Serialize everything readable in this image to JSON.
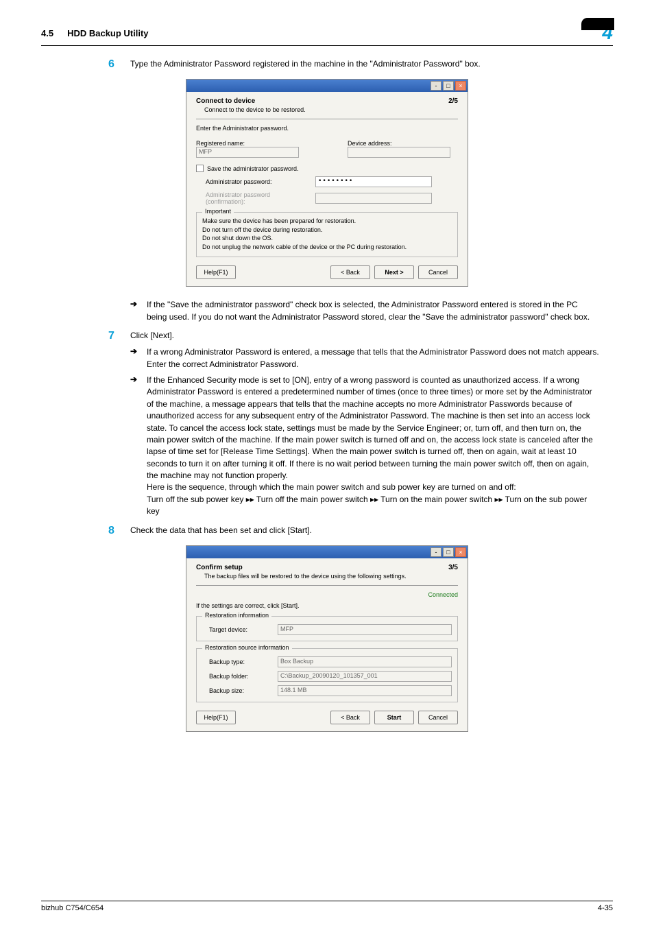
{
  "header": {
    "section_number": "4.5",
    "section_title": "HDD Backup Utility",
    "chapter_number": "4"
  },
  "steps": {
    "s6": {
      "num": "6",
      "text": "Type the Administrator Password registered in the machine in the \"Administrator Password\" box."
    },
    "s6_note": "If the \"Save the administrator password\" check box is selected, the Administrator Password entered is stored in the PC being used. If you do not want the Administrator Password stored, clear the \"Save the administrator password\" check box.",
    "s7": {
      "num": "7",
      "text": "Click [Next]."
    },
    "s7_b1": "If a wrong Administrator Password is entered, a message that tells that the Administrator Password does not match appears. Enter the correct Administrator Password.",
    "s7_b2": "If the Enhanced Security mode is set to [ON], entry of a wrong password is counted as unauthorized access. If a wrong Administrator Password is entered a predetermined number of times (once to three times) or more set by the Administrator of the machine, a message appears that tells that the machine accepts no more Administrator Passwords because of unauthorized access for any subsequent entry of the Administrator Password. The machine is then set into an access lock state. To cancel the access lock state, settings must be made by the Service Engineer; or, turn off, and then turn on, the main power switch of the machine. If the main power switch is turned off and on, the access lock state is canceled after the lapse of time set for [Release Time Settings]. When the main power switch is turned off, then on again, wait at least 10 seconds to turn it on after turning it off. If there is no wait period between turning the main power switch off, then on again, the machine may not function properly.",
    "s7_b2_cont1": "Here is the sequence, through which the main power switch and sub power key are turned on and off:",
    "s7_b2_cont2": "Turn off the sub power key ▸▸ Turn off the main power switch ▸▸ Turn on the main power switch ▸▸ Turn on the sub power key",
    "s8": {
      "num": "8",
      "text": "Check the data that has been set and click [Start]."
    }
  },
  "dialog1": {
    "title": "Connect to device",
    "subtitle": "Connect to the device to be restored.",
    "step": "2/5",
    "enter_pw": "Enter the Administrator password.",
    "reg_name_label": "Registered name:",
    "reg_name_value": "MFP",
    "dev_addr_label": "Device address:",
    "dev_addr_value": "",
    "save_pw": "Save the administrator password.",
    "admin_pw_label": "Administrator password:",
    "admin_pw_value": "••••••••",
    "admin_pw_confirm_label": "Administrator password (confirmation):",
    "important_legend": "Important",
    "important_l1": "Make sure the device has been prepared for restoration.",
    "important_l2": "Do not turn off the device during restoration.",
    "important_l3": "Do not shut down the OS.",
    "important_l4": "Do not unplug the network cable of the device or the PC during restoration.",
    "help": "Help(F1)",
    "back": "< Back",
    "next": "Next >",
    "cancel": "Cancel"
  },
  "dialog2": {
    "title": "Confirm setup",
    "subtitle": "The backup files will be restored to the device using the following settings.",
    "step": "3/5",
    "connected": "Connected",
    "instruction": "If the settings are correct, click [Start].",
    "rest_info_legend": "Restoration information",
    "target_device_label": "Target device:",
    "target_device_value": "MFP",
    "rest_src_legend": "Restoration source information",
    "backup_type_label": "Backup type:",
    "backup_type_value": "Box Backup",
    "backup_folder_label": "Backup folder:",
    "backup_folder_value": "C:\\Backup_20090120_101357_001",
    "backup_size_label": "Backup size:",
    "backup_size_value": "148.1 MB",
    "help": "Help(F1)",
    "back": "< Back",
    "start": "Start",
    "cancel": "Cancel"
  },
  "footer": {
    "product": "bizhub C754/C654",
    "page_num": "4-35"
  }
}
